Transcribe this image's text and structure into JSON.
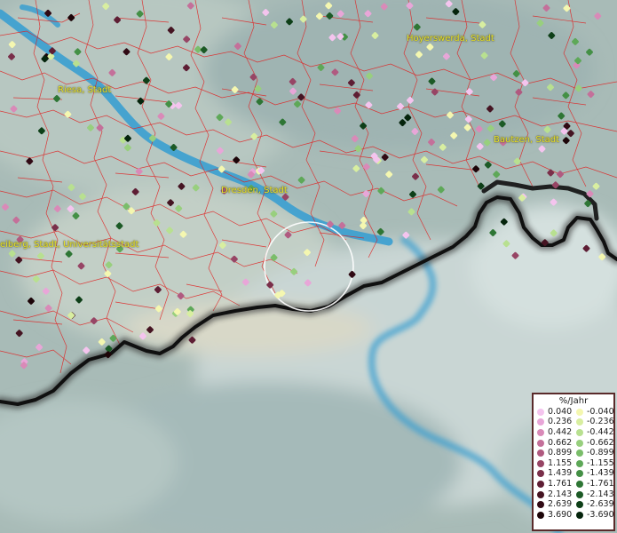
{
  "places": [
    {
      "name": "Hoyerswerda, Stadt"
    },
    {
      "name": "Riesa, Stadt"
    },
    {
      "name": "Bautzen, Stadt"
    },
    {
      "name": "Dresden, Stadt"
    },
    {
      "name": "eiberg, Stadt, Universitätsstadt"
    }
  ],
  "legend": {
    "title": "%/Jahr",
    "positive": [
      "0.040",
      "0.236",
      "0.442",
      "0.662",
      "0.899",
      "1.155",
      "1.439",
      "1.761",
      "2.143",
      "2.639",
      "3.690"
    ],
    "negative": [
      "-0.040",
      "-0.236",
      "-0.442",
      "-0.662",
      "-0.899",
      "-1.155",
      "-1.439",
      "-1.761",
      "-2.143",
      "-2.639",
      "-3.690"
    ],
    "positive_colors": [
      "#f4c4ee",
      "#e8a6d8",
      "#d98ab8",
      "#c4709a",
      "#b05a80",
      "#974565",
      "#7a2f4a",
      "#5e1e34",
      "#451422",
      "#300a14",
      "#1c0408"
    ],
    "negative_colors": [
      "#f4f7b0",
      "#d8eea0",
      "#b8e090",
      "#98cf7e",
      "#7abd6a",
      "#5ea858",
      "#449046",
      "#2e7635",
      "#1c5a26",
      "#0e3f18",
      "#05240c"
    ]
  },
  "colors": {
    "water": "#3a9fd0",
    "borders": "#e02020",
    "state_border": "#111111"
  }
}
